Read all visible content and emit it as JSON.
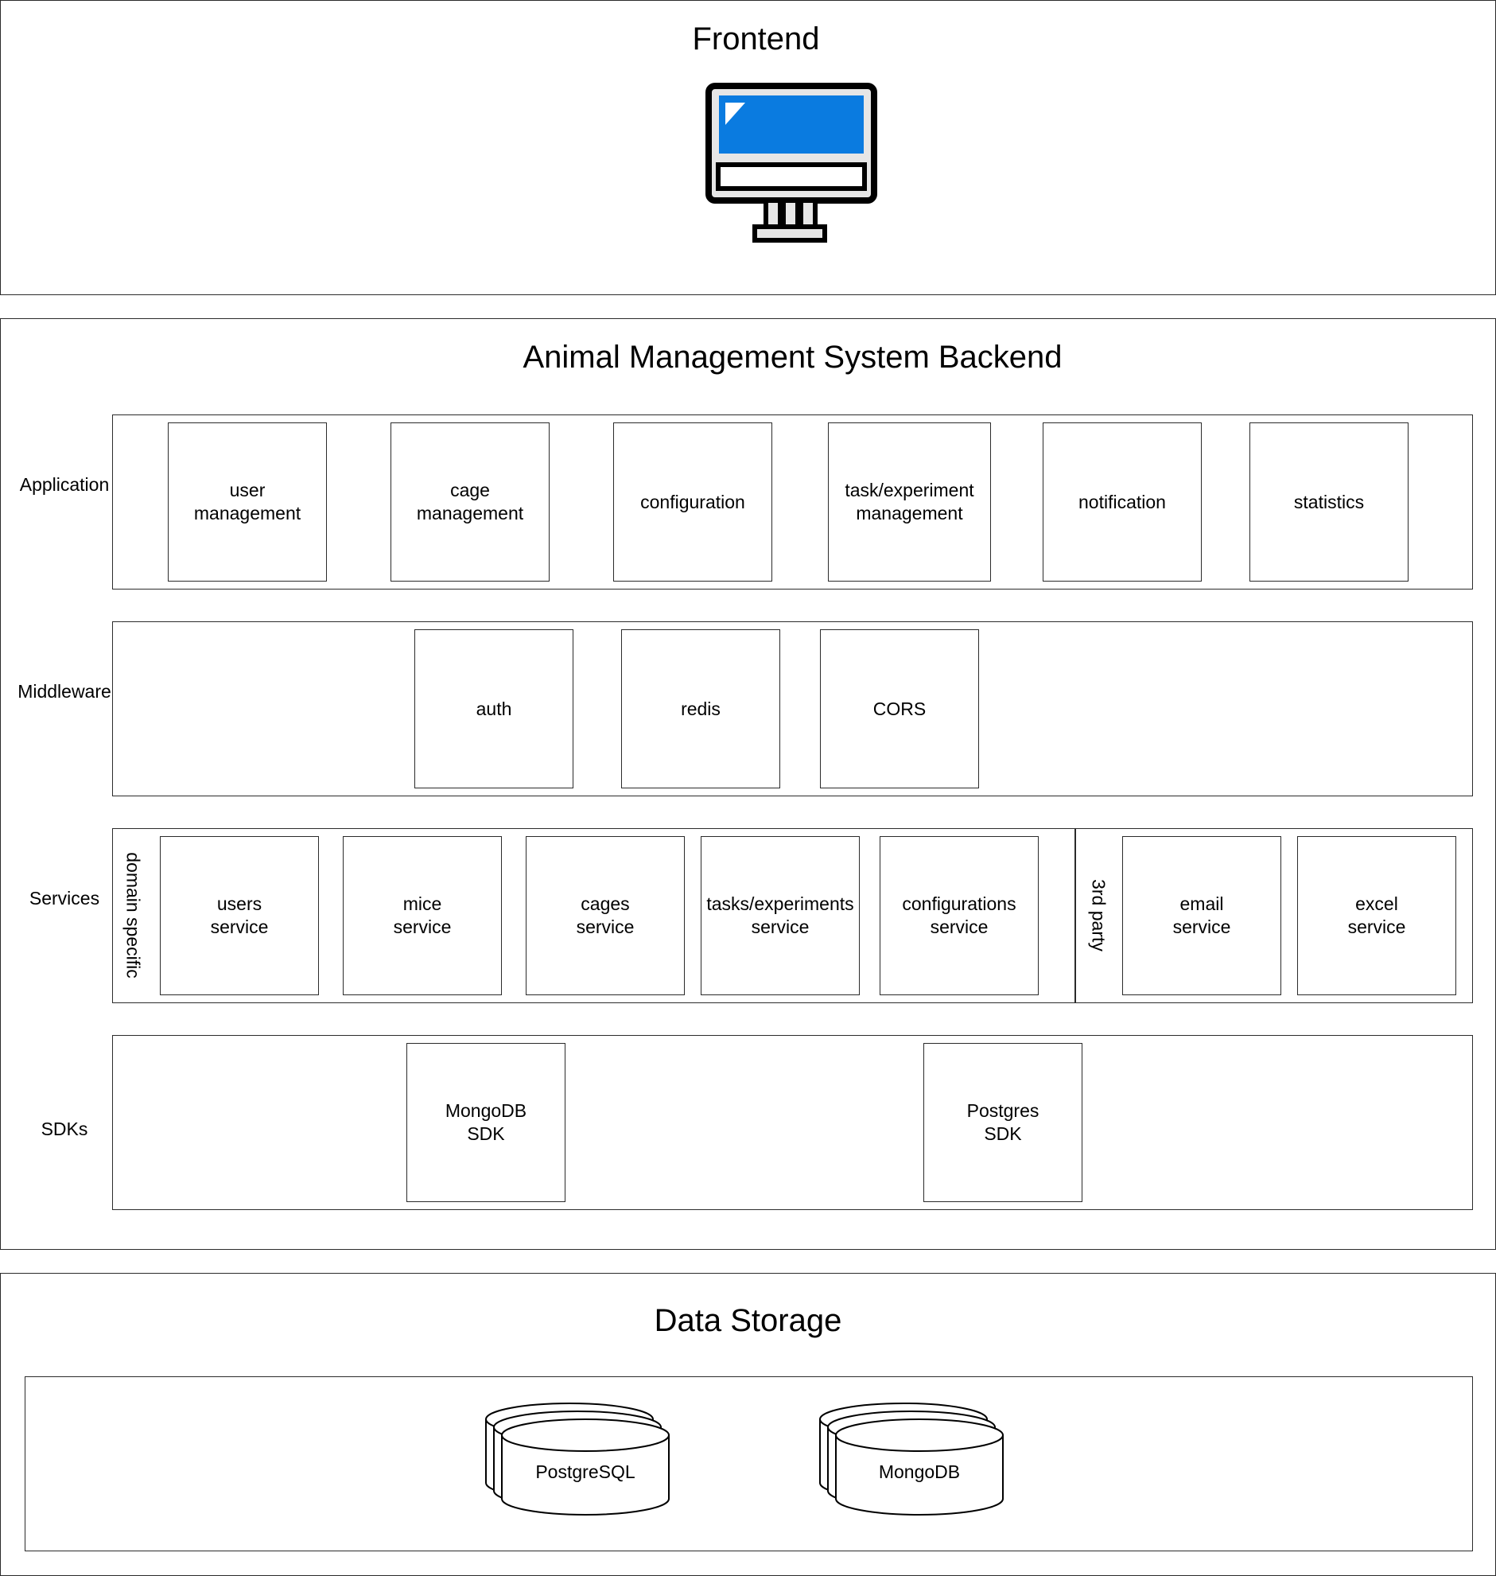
{
  "frontend": {
    "title": "Frontend"
  },
  "backend": {
    "title": "Animal Management System Backend",
    "layers": {
      "application": {
        "label": "Application",
        "components": [
          "user\nmanagement",
          "cage\nmanagement",
          "configuration",
          "task/experiment\nmanagement",
          "notification",
          "statistics"
        ]
      },
      "middleware": {
        "label": "Middleware",
        "components": [
          "auth",
          "redis",
          "CORS"
        ]
      },
      "services": {
        "label": "Services",
        "domain_group_label": "domain specific",
        "domain_components": [
          "users\nservice",
          "mice\nservice",
          "cages\nservice",
          "tasks/experiments\nservice",
          "configurations\nservice"
        ],
        "third_party_group_label": "3rd party",
        "third_party_components": [
          "email\nservice",
          "excel\nservice"
        ]
      },
      "sdks": {
        "label": "SDKs",
        "components": [
          "MongoDB\nSDK",
          "Postgres\nSDK"
        ]
      }
    }
  },
  "storage": {
    "title": "Data Storage",
    "databases": [
      "PostgreSQL",
      "MongoDB"
    ]
  },
  "colors": {
    "monitor_screen": "#0a7be0",
    "stroke": "#2b2b2b",
    "monitor_body": "#e6e6e6"
  },
  "icons": {
    "frontend": "desktop-monitor-icon",
    "database": "database-stack-icon"
  }
}
